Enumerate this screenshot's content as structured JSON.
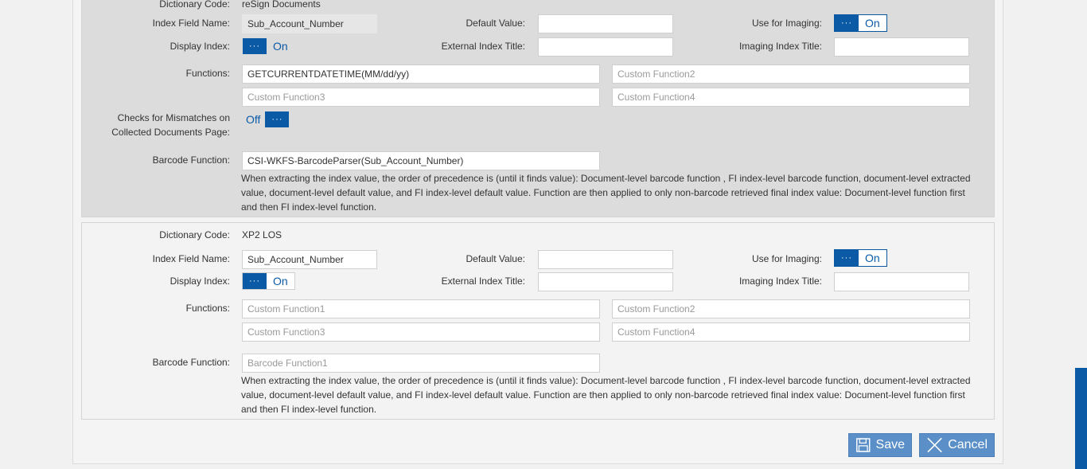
{
  "section1": {
    "dictionary_code_label": "Dictionary Code:",
    "dictionary_code_value": "reSign Documents",
    "index_field_name_label": "Index Field Name:",
    "index_field_name_value": "Sub_Account_Number",
    "default_value_label": "Default Value:",
    "default_value_value": "",
    "use_for_imaging_label": "Use for Imaging:",
    "use_for_imaging_state": "On",
    "display_index_label": "Display Index:",
    "display_index_state": "On",
    "external_index_title_label": "External Index Title:",
    "external_index_title_value": "",
    "imaging_index_title_label": "Imaging Index Title:",
    "imaging_index_title_value": "",
    "functions_label": "Functions:",
    "function1_value": "GETCURRENTDATETIME(MM/dd/yy)",
    "function2_placeholder": "Custom Function2",
    "function3_placeholder": "Custom Function3",
    "function4_placeholder": "Custom Function4",
    "mismatch_label_line1": "Checks for Mismatches on",
    "mismatch_label_line2": "Collected Documents Page:",
    "mismatch_state": "Off",
    "barcode_function_label": "Barcode Function:",
    "barcode_function_value": "CSI-WKFS-BarcodeParser(Sub_Account_Number)",
    "note_line1": "When extracting the index value, the order of precedence is (until it finds value): Document-level barcode function , FI index-level barcode function, document-level extracted",
    "note_line2": "value, document-level default value, and FI index-level default value. Function are then applied to only non-barcode retrieved final index value: Document-level function first",
    "note_line3": "and then FI index-level function."
  },
  "section2": {
    "dictionary_code_label": "Dictionary Code:",
    "dictionary_code_value": "XP2 LOS",
    "index_field_name_label": "Index Field Name:",
    "index_field_name_value": "Sub_Account_Number",
    "default_value_label": "Default Value:",
    "default_value_value": "",
    "use_for_imaging_label": "Use for Imaging:",
    "use_for_imaging_state": "On",
    "display_index_label": "Display Index:",
    "display_index_state": "On",
    "external_index_title_label": "External Index Title:",
    "external_index_title_value": "",
    "imaging_index_title_label": "Imaging Index Title:",
    "imaging_index_title_value": "",
    "functions_label": "Functions:",
    "function1_placeholder": "Custom Function1",
    "function2_placeholder": "Custom Function2",
    "function3_placeholder": "Custom Function3",
    "function4_placeholder": "Custom Function4",
    "barcode_function_label": "Barcode Function:",
    "barcode_function_placeholder": "Barcode Function1",
    "note_line1": "When extracting the index value, the order of precedence is (until it finds value): Document-level barcode function , FI index-level barcode function, document-level extracted",
    "note_line2": "value, document-level default value, and FI index-level default value. Function are then applied to only non-barcode retrieved final index value: Document-level function first",
    "note_line3": "and then FI index-level function."
  },
  "toggle_dots": "···",
  "actions": {
    "save_label": "Save",
    "cancel_label": "Cancel"
  },
  "colors": {
    "accent": "#0a5aa6",
    "button": "#5a8fc8"
  }
}
